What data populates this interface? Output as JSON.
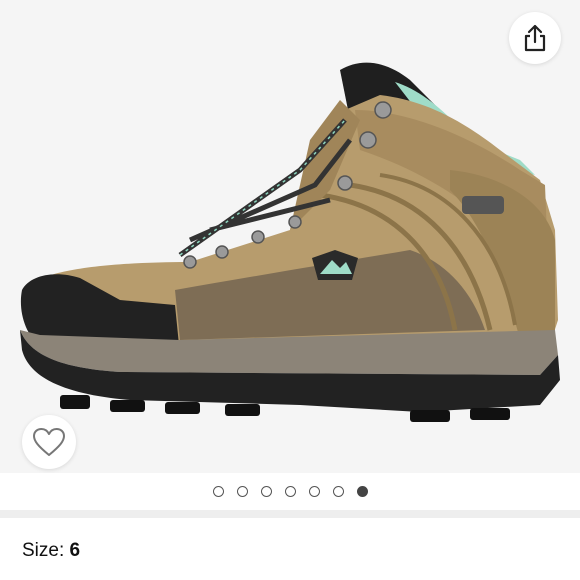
{
  "product": {
    "image_icon": "hiking-boot-photo",
    "image_count": 7,
    "active_image_index": 6
  },
  "actions": {
    "share_icon": "share-icon",
    "wishlist_icon": "heart-icon"
  },
  "details": {
    "size_label": "Size:",
    "size_value": "6"
  }
}
